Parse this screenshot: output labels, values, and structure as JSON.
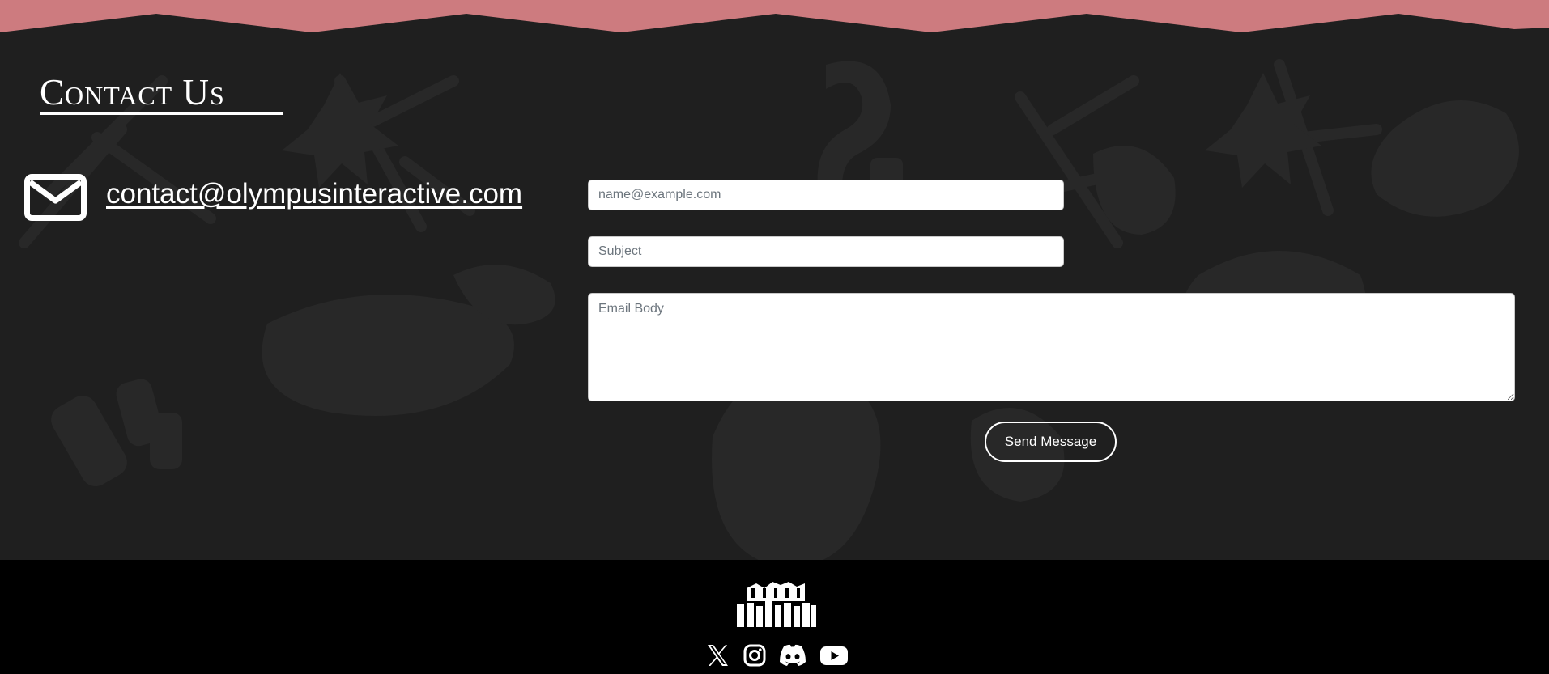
{
  "colors": {
    "accent_band": "#cd7b7f",
    "background": "#1f1f1f",
    "doodle": "#282828",
    "footer": "#000000",
    "text": "#ffffff"
  },
  "contact": {
    "title": "Contact Us",
    "email": "contact@olympusinteractive.com",
    "icon": "envelope-icon"
  },
  "form": {
    "email_placeholder": "name@example.com",
    "subject_placeholder": "Subject",
    "body_placeholder": "Email Body",
    "send_label": "Send Message"
  },
  "footer": {
    "logo_icon": "olympus-interactive-logo",
    "social_icons": [
      "x-icon",
      "instagram-icon",
      "discord-icon",
      "youtube-icon"
    ]
  }
}
